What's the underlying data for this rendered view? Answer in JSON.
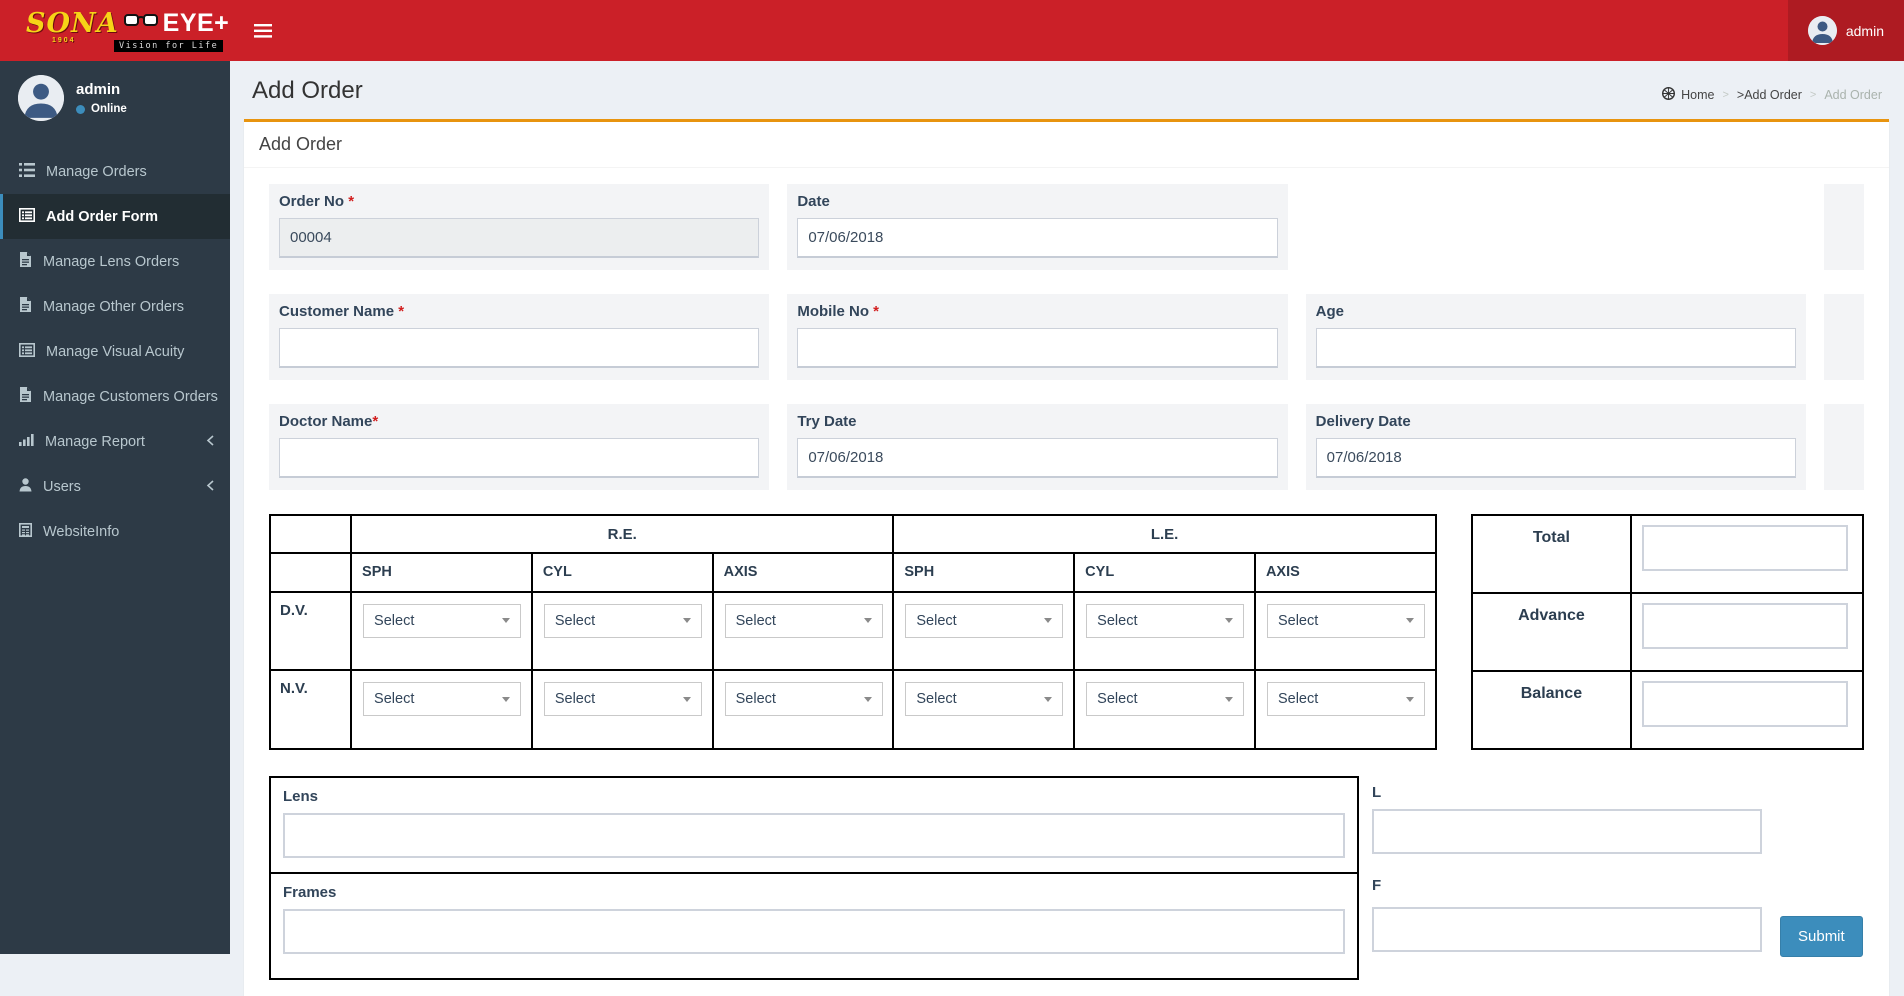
{
  "navbar": {
    "brand": {
      "sona": "SONA",
      "year": "1904",
      "eye": "EYE+",
      "tagline": "Vision for Life"
    },
    "user": "admin"
  },
  "sidebar": {
    "user": {
      "name": "admin",
      "status": "Online"
    },
    "items": [
      {
        "label": "Manage Orders"
      },
      {
        "label": "Add Order Form"
      },
      {
        "label": "Manage Lens Orders"
      },
      {
        "label": "Manage Other Orders"
      },
      {
        "label": "Manage Visual Acuity"
      },
      {
        "label": "Manage Customers Orders"
      },
      {
        "label": "Manage Report"
      },
      {
        "label": "Users"
      },
      {
        "label": "WebsiteInfo"
      }
    ]
  },
  "header": {
    "title": "Add Order",
    "breadcrumb": [
      {
        "label": "Home"
      },
      {
        "label": ">Add Order"
      },
      {
        "label": "Add Order"
      }
    ]
  },
  "box": {
    "title": "Add Order"
  },
  "form": {
    "required_mark": "*",
    "order_no": {
      "label": "Order No",
      "value": "00004"
    },
    "date": {
      "label": "Date",
      "value": "07/06/2018"
    },
    "customer_name": {
      "label": "Customer Name",
      "value": ""
    },
    "mobile_no": {
      "label": "Mobile No",
      "value": ""
    },
    "age": {
      "label": "Age",
      "value": ""
    },
    "doctor_name": {
      "label": "Doctor Name",
      "value": ""
    },
    "try_date": {
      "label": "Try Date",
      "value": "07/06/2018"
    },
    "delivery_date": {
      "label": "Delivery Date",
      "value": "07/06/2018"
    }
  },
  "rx_table": {
    "eye_groups": [
      "R.E.",
      "L.E."
    ],
    "columns": [
      "SPH",
      "CYL",
      "AXIS",
      "SPH",
      "CYL",
      "AXIS"
    ],
    "rows": [
      "D.V.",
      "N.V."
    ],
    "select_placeholder": "Select"
  },
  "totals": {
    "rows": [
      {
        "label": "Total",
        "value": ""
      },
      {
        "label": "Advance",
        "value": ""
      },
      {
        "label": "Balance",
        "value": ""
      }
    ]
  },
  "bottom": {
    "lens_label": "Lens",
    "lens_value": "",
    "frames_label": "Frames",
    "frames_value": "",
    "l_label": "L",
    "l_value": "",
    "f_label": "F",
    "f_value": "",
    "submit_label": "Submit"
  },
  "colors": {
    "navbar_red": "#cb2028",
    "accent_orange": "#e8940f",
    "primary_blue": "#3c8dbc",
    "sidebar_dark": "#2d3a46"
  }
}
